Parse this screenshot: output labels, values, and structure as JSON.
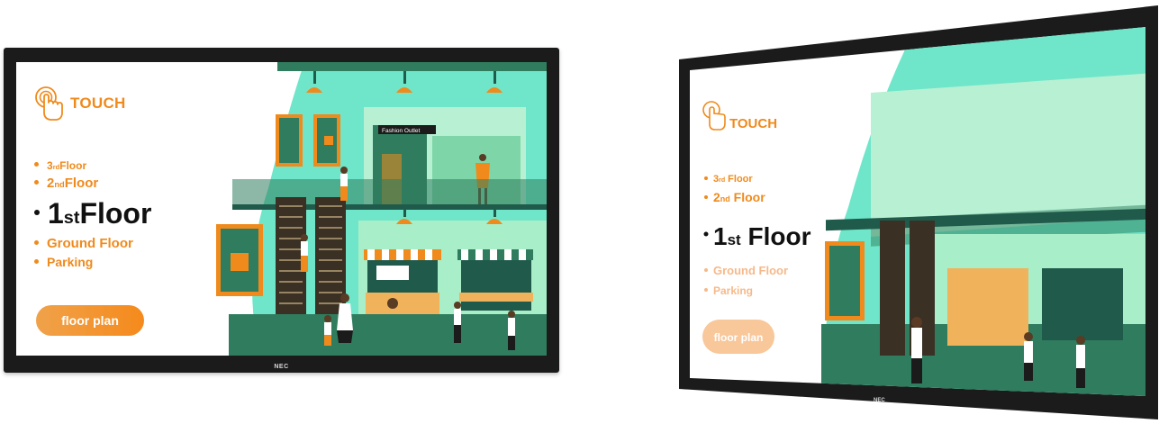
{
  "touch_label": "TOUCH",
  "floors": [
    {
      "main": "3",
      "suffix": "rd",
      "rest": " Floor"
    },
    {
      "main": "2",
      "suffix": "nd",
      "rest": " Floor"
    },
    {
      "main": "1",
      "suffix": "st",
      "rest": " Floor"
    },
    {
      "main": "Ground Floor",
      "suffix": "",
      "rest": ""
    },
    {
      "main": "Parking",
      "suffix": "",
      "rest": ""
    }
  ],
  "active_floor_index": 2,
  "floor_plan_button": "floor plan",
  "store_sign": "Fashion Outlet",
  "bezel_brand": "NEC",
  "colors": {
    "accent": "#f08a1c",
    "active": "#111111",
    "mint": "#6fe6c9",
    "teal_dark": "#1f5a4a",
    "green_mid": "#2f7d5e",
    "bezel": "#1b1b1b"
  }
}
